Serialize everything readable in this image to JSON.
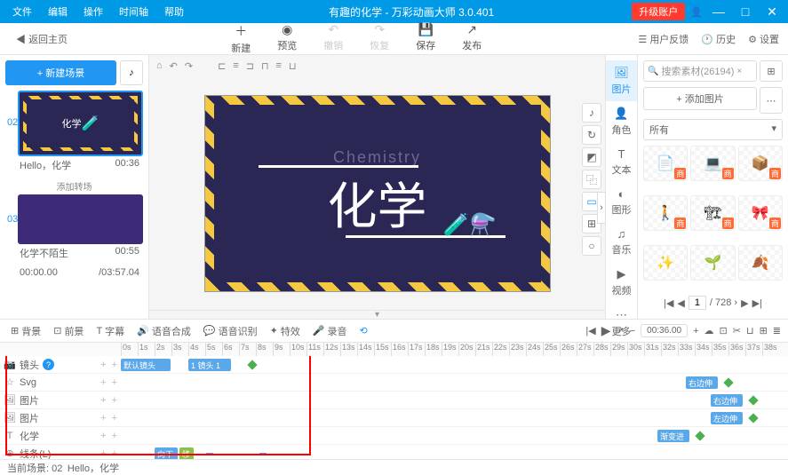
{
  "title": "有趣的化学 - 万彩动画大师 3.0.401",
  "menu": [
    "文件",
    "编辑",
    "操作",
    "时间轴",
    "帮助"
  ],
  "upgrade": "升级账户",
  "toolbar": {
    "back": "返回主页",
    "items": [
      "新建",
      "预览",
      "撤销",
      "恢复",
      "保存",
      "发布"
    ],
    "right": [
      "用户反馈",
      "历史",
      "设置"
    ]
  },
  "left": {
    "new": "+ 新建场景",
    "scene1": {
      "num": "02",
      "label": "Hello，化学",
      "time": "00:36"
    },
    "trans": "添加转场",
    "scene2": {
      "num": "03",
      "label": "化学不陌生",
      "time": "00:55"
    },
    "t1": "00:00.00",
    "t2": "/03:57.04",
    "thumb_text": "化学"
  },
  "canvas": {
    "en": "Chemistry",
    "cn": "化学"
  },
  "tabs": [
    "图片",
    "角色",
    "文本",
    "图形",
    "音乐",
    "视频",
    "更多"
  ],
  "right": {
    "search": "搜索素材(26194)",
    "add": "+ 添加图片",
    "cat": "所有",
    "badge": "商",
    "page": "1",
    "total": "/ 728"
  },
  "tl": {
    "bg": "背景",
    "fg": "前景",
    "sub": "字幕",
    "tts": "语音合成",
    "asr": "语音识别",
    "fx": "特效",
    "rec": "录音",
    "time": "00:36.00"
  },
  "tracks": {
    "cam": "镜头",
    "svg": "Svg",
    "img": "图片",
    "chem": "化学",
    "line": "线条(L)",
    "clips": {
      "default": "默认镜头",
      "c2": "1 镜头 1",
      "right1": "右边伸",
      "right2": "右边伸",
      "left": "左边伸",
      "fade": "渐变进",
      "down": "向下",
      "mv": "移"
    }
  },
  "status": {
    "scene": "当前场景: 02",
    "label": "Hello，化学"
  }
}
